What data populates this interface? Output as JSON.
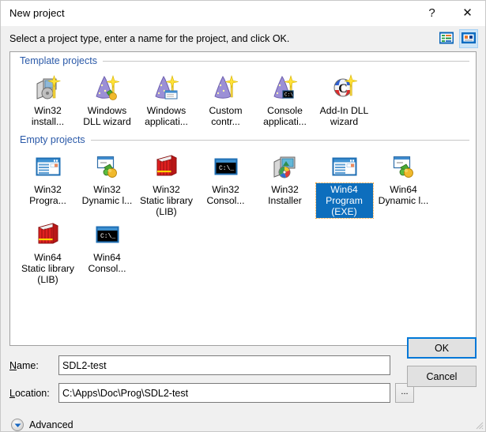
{
  "window": {
    "title": "New project",
    "help_label": "?",
    "close_label": "✕"
  },
  "instruction": {
    "text": "Select a project type, enter a name for the project, and click OK.",
    "view_list_icon": "list-view-icon",
    "view_tiles_icon": "tile-view-icon",
    "active_view": "tiles"
  },
  "groups": [
    {
      "title": "Template projects",
      "items": [
        {
          "label": "Win32 install...",
          "icon": "installer-wand-icon",
          "selected": false
        },
        {
          "label": "Windows DLL wizard",
          "icon": "wizard-hat-dll-icon",
          "selected": false
        },
        {
          "label": "Windows applicati...",
          "icon": "wizard-hat-window-icon",
          "selected": false
        },
        {
          "label": "Custom contr...",
          "icon": "wizard-hat-icon",
          "selected": false
        },
        {
          "label": "Console applicati...",
          "icon": "wizard-hat-console-icon",
          "selected": false
        },
        {
          "label": "Add-In DLL wizard",
          "icon": "c-ball-wand-icon",
          "selected": false
        }
      ]
    },
    {
      "title": "Empty projects",
      "items": [
        {
          "label": "Win32 Progra...",
          "icon": "window-program-icon",
          "selected": false
        },
        {
          "label": "Win32 Dynamic l...",
          "icon": "dll-puzzle-icon",
          "selected": false
        },
        {
          "label": "Win32 Static library (LIB)",
          "icon": "red-books-icon",
          "selected": false
        },
        {
          "label": "Win32 Consol...",
          "icon": "console-window-icon",
          "selected": false
        },
        {
          "label": "Win32 Installer",
          "icon": "installer-monitor-icon",
          "selected": false
        },
        {
          "label": "Win64 Program (EXE)",
          "icon": "window-program-icon",
          "selected": true
        },
        {
          "label": "Win64 Dynamic l...",
          "icon": "dll-puzzle-icon",
          "selected": false
        },
        {
          "label": "Win64 Static library (LIB)",
          "icon": "red-books-icon",
          "selected": false
        },
        {
          "label": "Win64 Consol...",
          "icon": "console-window-icon",
          "selected": false
        }
      ]
    }
  ],
  "form": {
    "name_label": "Name:",
    "name_value": "SDL2-test",
    "name_placeholder": "",
    "location_label": "Location:",
    "location_value": "C:\\Apps\\Doc\\Prog\\SDL2-test",
    "location_placeholder": "",
    "browse_label": "..."
  },
  "buttons": {
    "ok": "OK",
    "cancel": "Cancel"
  },
  "advanced": {
    "label": "Advanced",
    "chevron_icon": "chevron-down-icon"
  },
  "colors": {
    "selection_blue": "#0d6ebd",
    "group_title_blue": "#2a59a8",
    "default_button_border": "#0078d7",
    "dialog_bg": "#f0f0f0"
  }
}
